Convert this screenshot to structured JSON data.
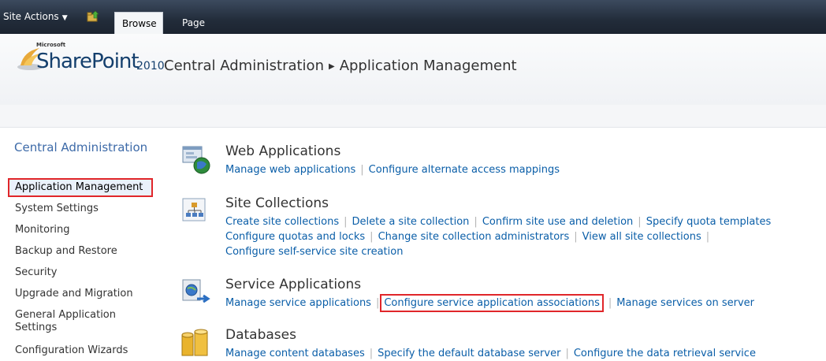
{
  "ribbon": {
    "site_actions": "Site Actions",
    "tabs": [
      "Browse",
      "Page"
    ]
  },
  "header": {
    "brand_ms": "Microsoft",
    "brand": "SharePoint",
    "brand_version": "2010",
    "breadcrumb": [
      "Central Administration",
      "Application Management"
    ]
  },
  "leftnav": {
    "title": "Central Administration",
    "items": [
      "Application Management",
      "System Settings",
      "Monitoring",
      "Backup and Restore",
      "Security",
      "Upgrade and Migration",
      "General Application Settings",
      "Configuration Wizards"
    ]
  },
  "sections": [
    {
      "title": "Web Applications",
      "icon": "web-applications-icon",
      "links": [
        "Manage web applications",
        "Configure alternate access mappings"
      ]
    },
    {
      "title": "Site Collections",
      "icon": "site-collections-icon",
      "links": [
        "Create site collections",
        "Delete a site collection",
        "Confirm site use and deletion",
        "Specify quota templates",
        "Configure quotas and locks",
        "Change site collection administrators",
        "View all site collections",
        "Configure self-service site creation"
      ]
    },
    {
      "title": "Service Applications",
      "icon": "service-applications-icon",
      "links": [
        "Manage service applications",
        "Configure service application associations",
        "Manage services on server"
      ]
    },
    {
      "title": "Databases",
      "icon": "databases-icon",
      "links": [
        "Manage content databases",
        "Specify the default database server",
        "Configure the data retrieval service"
      ]
    }
  ],
  "colors": {
    "accent_link": "#0a5ea8",
    "highlight_border": "#e0262a",
    "ribbon": "#222c3a"
  }
}
